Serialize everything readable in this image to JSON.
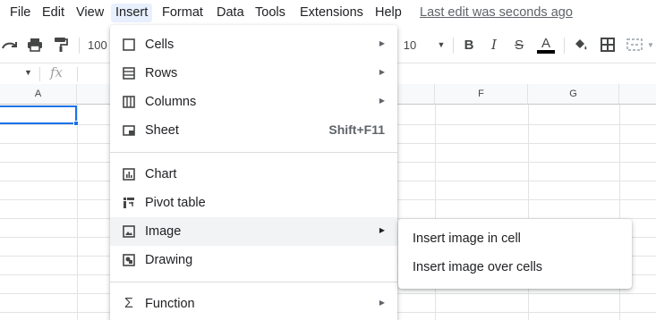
{
  "menubar": {
    "items": [
      {
        "label": "File"
      },
      {
        "label": "Edit"
      },
      {
        "label": "View"
      },
      {
        "label": "Insert"
      },
      {
        "label": "Format"
      },
      {
        "label": "Data"
      },
      {
        "label": "Tools"
      },
      {
        "label": "Extensions"
      },
      {
        "label": "Help"
      }
    ],
    "last_edit": "Last edit was seconds ago"
  },
  "toolbar": {
    "zoom": "100",
    "font_size": "10"
  },
  "formula_bar": {
    "fx": "fx"
  },
  "columns": {
    "a": "A",
    "f": "F",
    "g": "G"
  },
  "insert_menu": {
    "items": [
      {
        "label": "Cells",
        "icon": "cells-icon",
        "has_submenu": true
      },
      {
        "label": "Rows",
        "icon": "rows-icon",
        "has_submenu": true
      },
      {
        "label": "Columns",
        "icon": "columns-icon",
        "has_submenu": true
      },
      {
        "label": "Sheet",
        "icon": "sheet-icon",
        "shortcut": "Shift+F11"
      },
      {
        "label": "Chart",
        "icon": "chart-icon"
      },
      {
        "label": "Pivot table",
        "icon": "pivot-table-icon"
      },
      {
        "label": "Image",
        "icon": "image-icon",
        "has_submenu": true,
        "highlighted": true
      },
      {
        "label": "Drawing",
        "icon": "drawing-icon"
      },
      {
        "label": "Function",
        "icon": "sigma-icon",
        "has_submenu": true
      }
    ]
  },
  "image_submenu": {
    "items": [
      {
        "label": "Insert image in cell"
      },
      {
        "label": "Insert image over cells"
      }
    ]
  },
  "colors": {
    "selection": "#1a73e8",
    "menu_active": "#e8f0fe",
    "hover": "#f1f3f4"
  }
}
